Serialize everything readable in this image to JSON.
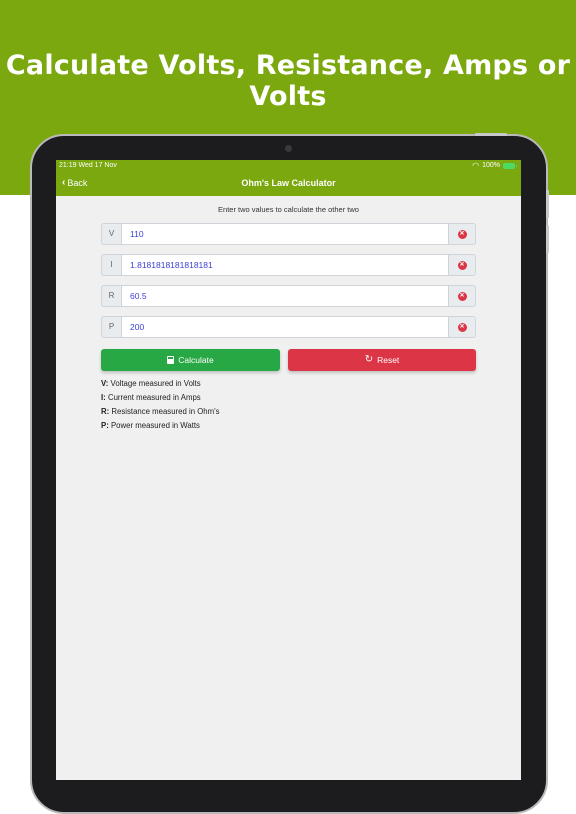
{
  "headline": "Calculate Volts, Resistance, Amps or Volts",
  "status_bar": {
    "time_date": "21:19  Wed 17 Nov",
    "battery": "100%"
  },
  "nav": {
    "back_label": "Back",
    "title": "Ohm's Law Calculator"
  },
  "instructions": "Enter two values to calculate the other two",
  "fields": [
    {
      "label": "V",
      "value": "110"
    },
    {
      "label": "I",
      "value": "1.8181818181818181"
    },
    {
      "label": "R",
      "value": "60.5"
    },
    {
      "label": "P",
      "value": "200"
    }
  ],
  "buttons": {
    "calculate": "Calculate",
    "reset": "Reset"
  },
  "legend": [
    {
      "key": "V:",
      "text": "Voltage measured in Volts"
    },
    {
      "key": "I:",
      "text": "Current measured in Amps"
    },
    {
      "key": "R:",
      "text": "Resistance measured in Ohm's"
    },
    {
      "key": "P:",
      "text": "Power measured in Watts"
    }
  ],
  "colors": {
    "brand_green": "#7aa80e",
    "calculate_green": "#28a745",
    "reset_red": "#dc3545",
    "value_blue": "#3a3fd4"
  },
  "icons": {
    "back": "chevron-left-icon",
    "clear": "clear-circle-icon",
    "calculate": "calculator-icon",
    "reset": "refresh-icon"
  }
}
